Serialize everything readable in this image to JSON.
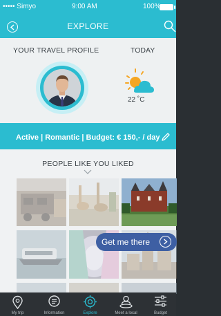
{
  "status_bar": {
    "carrier": "••••• Simyo",
    "time": "9:00 AM",
    "battery": "100%"
  },
  "header": {
    "title": "EXPLORE"
  },
  "profile": {
    "heading": "YOUR TRAVEL PROFILE",
    "avatar_alt": "profile-photo"
  },
  "weather": {
    "heading": "TODAY",
    "temperature": "22 ˚C",
    "condition_icon": "partly-cloudy-icon"
  },
  "preferences": {
    "text": "Active | Romantic | Budget: € 150,- / day"
  },
  "similar": {
    "heading": "PEOPLE LIKE YOU LIKED",
    "cta_label": "Get me there"
  },
  "tabs": [
    {
      "label": "My trip",
      "icon": "location-pin-icon"
    },
    {
      "label": "Information",
      "icon": "info-icon"
    },
    {
      "label": "Explore",
      "icon": "compass-icon",
      "active": true
    },
    {
      "label": "Meet a local",
      "icon": "person-pin-icon"
    },
    {
      "label": "Budget",
      "icon": "sliders-icon"
    }
  ],
  "colors": {
    "accent": "#2bbcd0",
    "cta": "#3e5fa3",
    "tabbar": "#2d3135"
  }
}
